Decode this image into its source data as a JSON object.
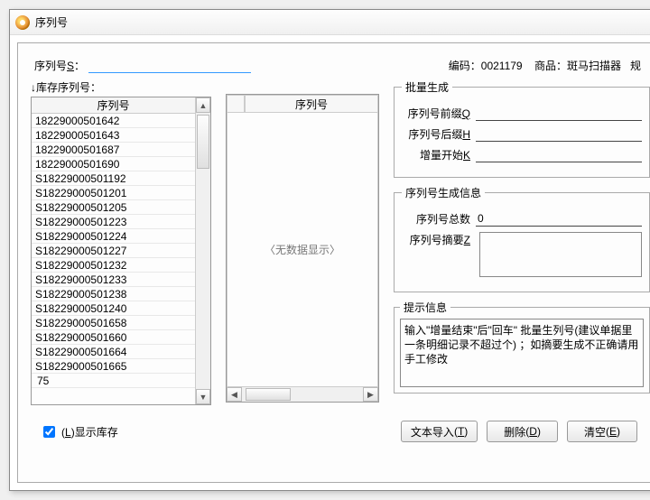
{
  "window": {
    "title": "序列号"
  },
  "top": {
    "serial_label": "序列号",
    "serial_hotkey": "S",
    "serial_sep": "：",
    "code_label": "编码：",
    "code_value": "0021179",
    "product_label": "商品：",
    "product_value": "斑马扫描器",
    "spec_label": "规"
  },
  "left": {
    "section_label": "↓库存序列号：",
    "header": "序列号",
    "rows": [
      "18229000501642",
      "18229000501643",
      "18229000501687",
      "18229000501690",
      "S18229000501192",
      "S18229000501201",
      "S18229000501205",
      "S18229000501223",
      "S18229000501224",
      "S18229000501227",
      "S18229000501232",
      "S18229000501233",
      "S18229000501238",
      "S18229000501240",
      "S18229000501658",
      "S18229000501660",
      "S18229000501664",
      "S18229000501665"
    ],
    "input_value": "75"
  },
  "mid": {
    "header": "序列号",
    "empty_text": "〈无数据显示〉"
  },
  "right": {
    "batch": {
      "legend": "批量生成",
      "prefix_label": "序列号前缀",
      "prefix_hotkey": "Q",
      "suffix_label": "序列号后缀",
      "suffix_hotkey": "H",
      "start_label": "增量开始",
      "start_hotkey": "K"
    },
    "info": {
      "legend": "序列号生成信息",
      "total_label": "序列号总数",
      "total_value": "0",
      "summary_label": "序列号摘要",
      "summary_hotkey": "Z"
    },
    "tips": {
      "legend": "提示信息",
      "text": "输入\"增量结束\"后\"回车\" 批量生列号(建议单据里一条明细记录不超过个) ；如摘要生成不正确请用手工修改"
    }
  },
  "bottom": {
    "show_stock_label": "显示库存",
    "show_stock_hotkey": "L",
    "show_stock_checked": true,
    "import_label": "文本导入",
    "import_hotkey": "T",
    "delete_label": "删除",
    "delete_hotkey": "D",
    "clear_label": "清空",
    "clear_hotkey": "E"
  }
}
